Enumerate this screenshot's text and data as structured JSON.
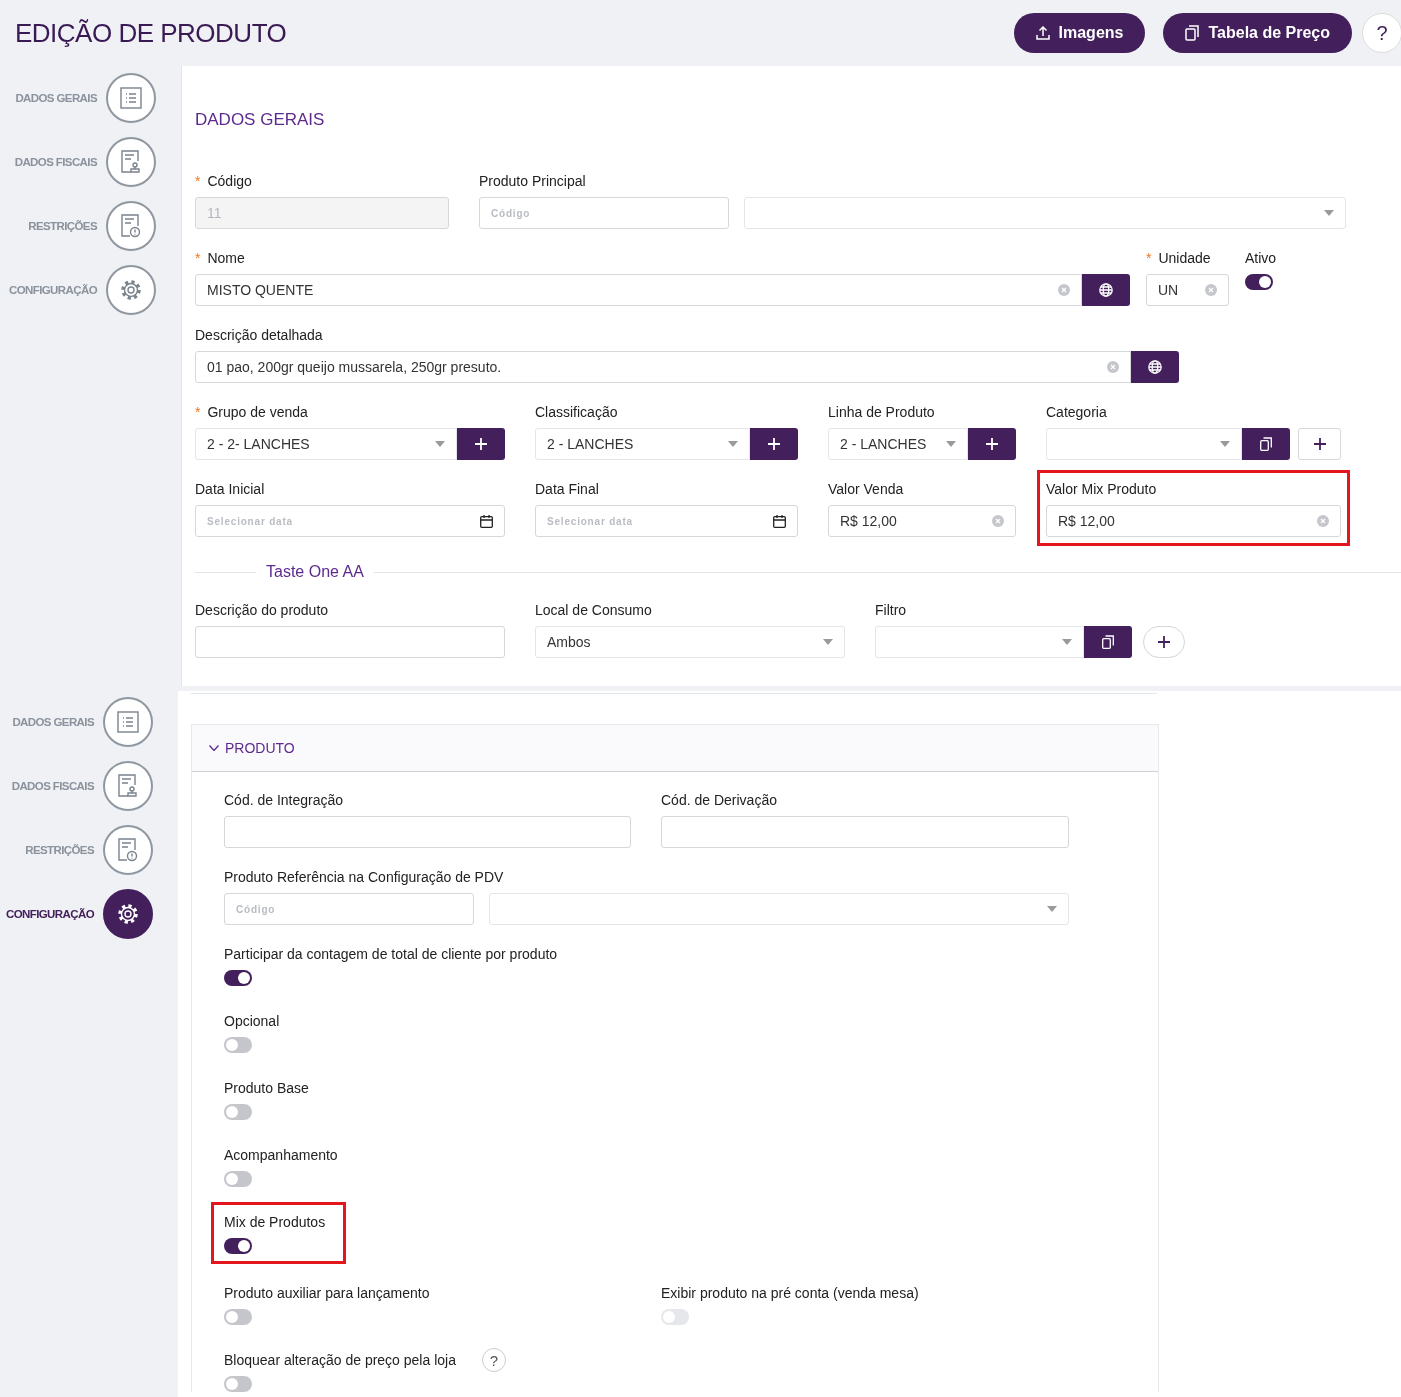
{
  "header": {
    "title": "EDIÇÃO DE PRODUTO",
    "buttons": [
      {
        "label": "Imagens"
      },
      {
        "label": "Tabela de Preço"
      }
    ],
    "help": "?"
  },
  "required_marker": "*",
  "top": {
    "sidebar": [
      {
        "label": "DADOS GERAIS",
        "selected": false
      },
      {
        "label": "DADOS FISCAIS",
        "selected": false
      },
      {
        "label": "RESTRIÇÕES",
        "selected": false
      },
      {
        "label": "CONFIGURAÇÃO",
        "selected": false
      }
    ],
    "section_title": "DADOS GERAIS",
    "rows": [
      [
        {
          "kind": "text",
          "label": "Código",
          "required": true,
          "value": "11",
          "disabled": true
        },
        {
          "kind": "lookup",
          "label": "Produto Principal",
          "placeholder": "Código"
        }
      ],
      [
        {
          "kind": "text",
          "label": "Nome",
          "required": true,
          "value": "MISTO QUENTE",
          "clearable": true,
          "actions": [
            {
              "kind": "translate"
            }
          ]
        },
        {
          "kind": "text",
          "label": "Unidade",
          "required": true,
          "value": "UN",
          "clearable": true
        },
        {
          "kind": "toggle",
          "label": "Ativo",
          "on": true
        }
      ],
      [
        {
          "kind": "text",
          "label": "Descrição detalhada",
          "value": "01 pao, 200gr queijo mussarela, 250gr presuto.",
          "clearable": true,
          "actions": [
            {
              "kind": "translate"
            }
          ]
        }
      ],
      [
        {
          "kind": "select",
          "label": "Grupo de venda",
          "required": true,
          "value": "2 - 2- LANCHES",
          "actions": [
            {
              "kind": "add"
            }
          ]
        },
        {
          "kind": "select",
          "label": "Classificação",
          "value": "2 - LANCHES",
          "actions": [
            {
              "kind": "add"
            }
          ]
        },
        {
          "kind": "select",
          "label": "Linha de Produto",
          "value": "2 - LANCHES",
          "actions": [
            {
              "kind": "add"
            }
          ]
        },
        {
          "kind": "select",
          "label": "Categoria",
          "actions": [
            {
              "kind": "copy"
            },
            {
              "kind": "add_outline"
            }
          ]
        }
      ],
      [
        {
          "kind": "date",
          "label": "Data Inicial",
          "placeholder": "Selecionar data"
        },
        {
          "kind": "date",
          "label": "Data Final",
          "placeholder": "Selecionar data"
        },
        {
          "kind": "text",
          "label": "Valor Venda",
          "value": "R$ 12,00",
          "clearable": true
        },
        {
          "kind": "text",
          "label": "Valor Mix Produto",
          "value": "R$ 12,00",
          "clearable": true,
          "highlighted": true
        }
      ]
    ],
    "group_title": "Taste One AA",
    "group_rows": [
      [
        {
          "kind": "text",
          "label": "Descrição do produto"
        },
        {
          "kind": "select",
          "label": "Local de Consumo",
          "value": "Ambos"
        },
        {
          "kind": "select",
          "label": "Filtro",
          "actions": [
            {
              "kind": "copy"
            },
            {
              "kind": "add_round"
            }
          ]
        }
      ]
    ]
  },
  "bottom": {
    "sidebar": [
      {
        "label": "DADOS GERAIS",
        "selected": false
      },
      {
        "label": "DADOS FISCAIS",
        "selected": false
      },
      {
        "label": "RESTRIÇÕES",
        "selected": false
      },
      {
        "label": "CONFIGURAÇÃO",
        "selected": true
      }
    ],
    "accordion": {
      "title": "PRODUTO",
      "expanded": true,
      "rows": [
        [
          {
            "kind": "text",
            "label": "Cód. de Integração"
          },
          {
            "kind": "text",
            "label": "Cód. de Derivação"
          }
        ],
        [
          {
            "kind": "lookup",
            "label": "Produto Referência na Configuração de PDV",
            "placeholder": "Código"
          }
        ]
      ],
      "toggle_rows": [
        [
          {
            "kind": "toggle",
            "label": "Participar da contagem de total de cliente por produto",
            "on": true,
            "disabled": false
          }
        ],
        [
          {
            "kind": "toggle",
            "label": "Opcional",
            "on": false,
            "disabled": false
          }
        ],
        [
          {
            "kind": "toggle",
            "label": "Produto Base",
            "on": false,
            "disabled": false
          }
        ],
        [
          {
            "kind": "toggle",
            "label": "Acompanhamento",
            "on": false,
            "disabled": false
          }
        ],
        [
          {
            "kind": "toggle",
            "label": "Mix de Produtos",
            "on": true,
            "disabled": false,
            "highlighted": true
          }
        ],
        [
          {
            "kind": "toggle",
            "label": "Produto auxiliar para lançamento",
            "on": false,
            "disabled": false
          },
          {
            "kind": "toggle",
            "label": "Exibir produto na pré conta (venda mesa)",
            "on": false,
            "disabled": true
          }
        ],
        [
          {
            "kind": "toggle",
            "label": "Bloquear alteração de preço pela loja",
            "on": false,
            "disabled": false,
            "help": "?"
          }
        ]
      ]
    }
  }
}
